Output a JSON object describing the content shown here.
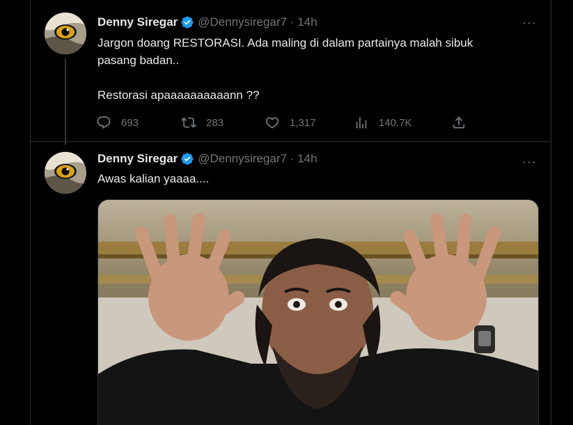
{
  "tweets": [
    {
      "author_name": "Denny Siregar",
      "handle_time": "@Dennysiregar7 · 14h",
      "more_label": "···",
      "text_lines": [
        "Jargon doang RESTORASI. Ada maling di dalam partainya malah sibuk",
        "pasang badan..",
        "Restorasi apaaaaaaaaaann ??"
      ],
      "stats": {
        "replies": "693",
        "retweets": "283",
        "likes": "1,317",
        "views": "140.7K"
      }
    },
    {
      "author_name": "Denny Siregar",
      "handle_time": "@Dennysiregar7 · 14h",
      "more_label": "···",
      "text": "Awas kalian yaaaa...."
    }
  ],
  "icons": {
    "verified": "verified-badge-icon",
    "reply": "reply-icon",
    "retweet": "retweet-icon",
    "like": "heart-icon",
    "views": "views-chart-icon",
    "share": "share-icon",
    "more": "more-dots-icon"
  },
  "colors": {
    "background": "#000000",
    "text_primary": "#e7e9ea",
    "text_secondary": "#71767b",
    "border": "#2f3336",
    "verified_blue": "#1d9bf0"
  }
}
